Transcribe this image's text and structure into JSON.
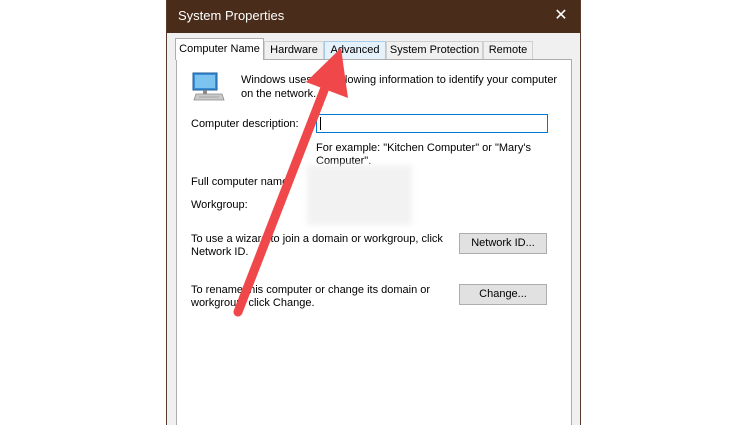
{
  "window": {
    "title": "System Properties",
    "close_glyph": "✕"
  },
  "tabs": [
    {
      "label": "Computer Name",
      "active": true
    },
    {
      "label": "Hardware",
      "active": false
    },
    {
      "label": "Advanced",
      "active": false
    },
    {
      "label": "System Protection",
      "active": false
    },
    {
      "label": "Remote",
      "active": false
    }
  ],
  "panel": {
    "intro_line1": "Windows uses the following information to identify your computer",
    "intro_line2": "on the network.",
    "description_label": "Computer description:",
    "description_value": "",
    "example_line1": "For example: \"Kitchen Computer\" or \"Mary's",
    "example_line2": "Computer\".",
    "full_name_label": "Full computer name:",
    "workgroup_label": "Workgroup:",
    "network_text_line1": "To use a wizard to join a domain or workgroup, click",
    "network_text_line2": "Network ID.",
    "network_button": "Network ID...",
    "rename_text_line1": "To rename this computer or change its domain or",
    "rename_text_line2": "workgroup, click Change.",
    "change_button": "Change..."
  },
  "icons": {
    "computer": "computer-monitor-icon",
    "annotation": "red-arrow-icon"
  },
  "colors": {
    "titlebar": "#4a2c1a",
    "arrow": "#f0484a",
    "focus": "#0078d7"
  }
}
